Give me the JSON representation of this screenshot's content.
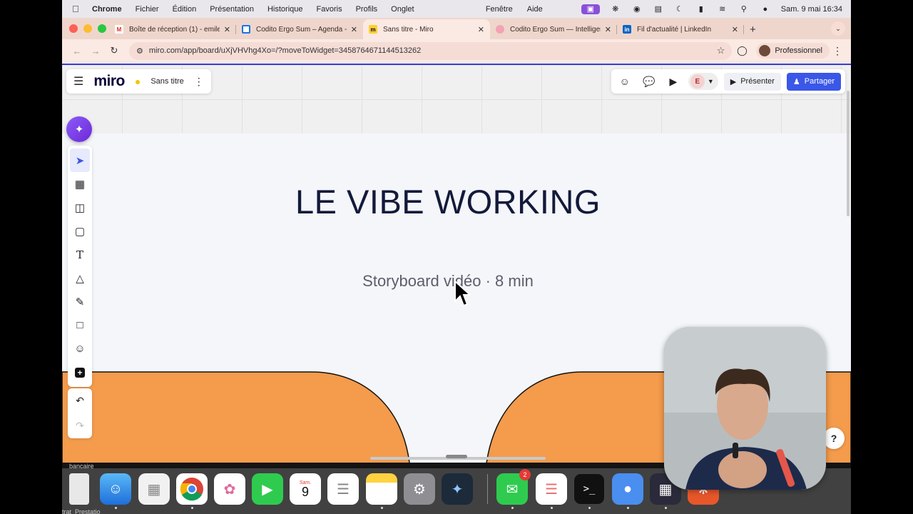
{
  "menubar": {
    "app": "Chrome",
    "items": [
      "Fichier",
      "Édition",
      "Présentation",
      "Historique",
      "Favoris",
      "Profils",
      "Onglet"
    ],
    "right_items": [
      "Fenêtre",
      "Aide"
    ],
    "clock": "Sam. 9 mai  16:34"
  },
  "browser": {
    "tabs": [
      {
        "title": "Boîte de réception (1) - emile",
        "favicon": "gmail-icon",
        "active": false
      },
      {
        "title": "Codito Ergo Sum – Agenda - ",
        "favicon": "calendar-icon",
        "active": false
      },
      {
        "title": "Sans titre - Miro",
        "favicon": "miro-icon",
        "active": true
      },
      {
        "title": "Codito Ergo Sum — Intelligen",
        "favicon": "brain-icon",
        "active": false
      },
      {
        "title": "Fil d'actualité | LinkedIn",
        "favicon": "linkedin-icon",
        "active": false
      }
    ],
    "url": "miro.com/app/board/uXjVHVhg4Xo=/?moveToWidget=3458764671144513262",
    "profile_label": "Professionnel"
  },
  "miro": {
    "logo": "miro",
    "board_name": "Sans titre",
    "present_label": "Présenter",
    "share_label": "Partager",
    "avatar_initial": "E",
    "slide": {
      "title": "LE VIBE WORKING",
      "subtitle": "Storyboard vidéo · 8 min"
    },
    "tools": [
      "select-tool",
      "templates-tool",
      "frame-layout-tool",
      "sticky-note-tool",
      "text-tool",
      "shapes-tool",
      "pen-tool",
      "crop-frame-tool",
      "stickers-tool",
      "add-more-tool"
    ]
  },
  "dock": {
    "fragment_top": "bancaire ",
    "fragment_bottom": "trat_Prestatio",
    "calendar_day": "Sam.",
    "calendar_date": "9",
    "messages_badge": "2"
  },
  "colors": {
    "orange_shape": "#f49b4c",
    "miro_accent": "#3a57e8",
    "title_color": "#131a3a"
  }
}
